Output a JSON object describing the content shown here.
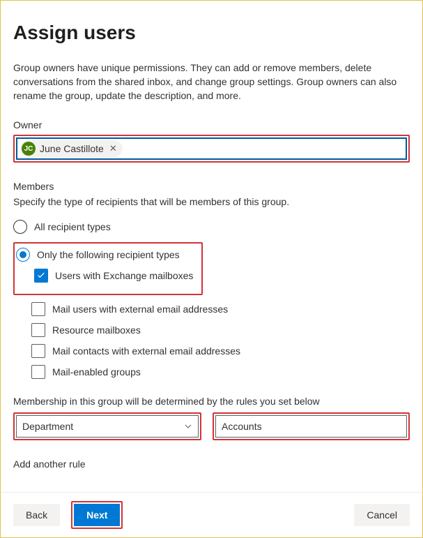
{
  "title": "Assign users",
  "intro": "Group owners have unique permissions. They can add or remove members, delete conversations from the shared inbox, and change group settings. Group owners can also rename the group, update the description, and more.",
  "owner": {
    "label": "Owner",
    "chip": {
      "initials": "JC",
      "name": "June Castillote"
    }
  },
  "members": {
    "label": "Members",
    "desc": "Specify the type of recipients that will be members of this group.",
    "options": {
      "all": "All recipient types",
      "only": "Only the following recipient types"
    },
    "types": {
      "exchange": "Users with Exchange mailboxes",
      "mailusers": "Mail users with external email addresses",
      "resource": "Resource mailboxes",
      "mailcontacts": "Mail contacts with external email addresses",
      "mailgroups": "Mail-enabled groups"
    }
  },
  "rules": {
    "label": "Membership in this group will be determined by the rules you set below",
    "attribute": "Department",
    "value": "Accounts",
    "add": "Add another rule"
  },
  "footer": {
    "back": "Back",
    "next": "Next",
    "cancel": "Cancel"
  }
}
